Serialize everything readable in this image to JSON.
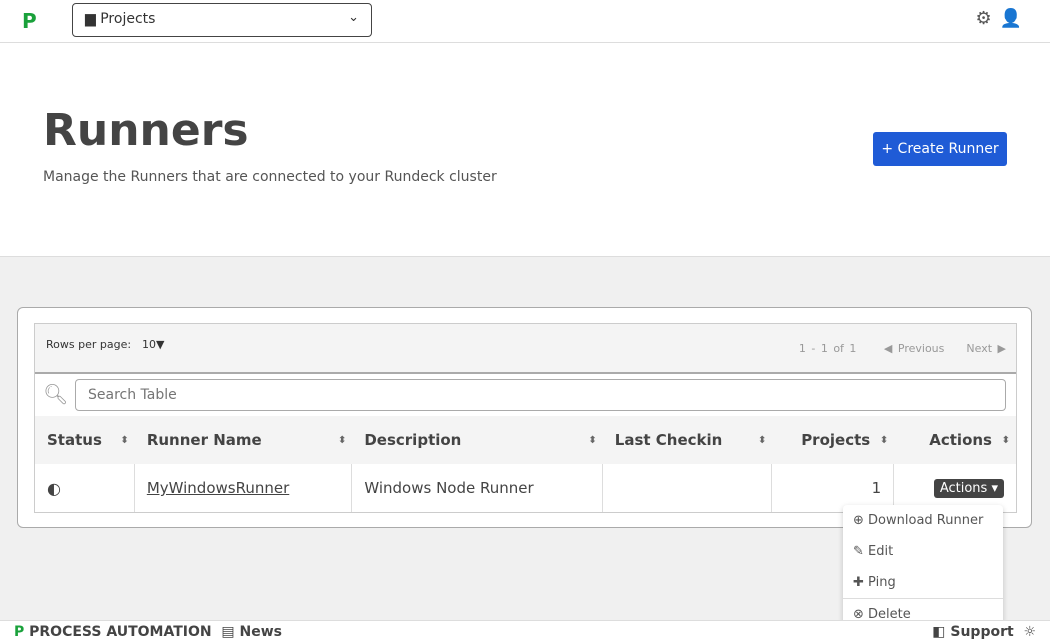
{
  "topbar": {
    "project_selector": "Projects"
  },
  "header": {
    "title": "Runners",
    "subtitle": "Manage the Runners that are connected to your Rundeck cluster",
    "create_label": "+ Create Runner"
  },
  "table": {
    "rows_per_page_label": "Rows per page:",
    "rows_per_page": "10",
    "page_info": "1 - 1 of 1",
    "previous": "Previous",
    "next": "Next",
    "search_placeholder": "Search Table",
    "columns": [
      "Status",
      "Runner Name",
      "Description",
      "Last Checkin",
      "Projects",
      "Actions"
    ],
    "rows": [
      {
        "status_icon": "half-circle-icon",
        "name": "MyWindowsRunner",
        "description": "Windows Node Runner",
        "last_checkin": "",
        "projects": "1",
        "actions_label": "Actions"
      }
    ]
  },
  "actions_menu": [
    "Download Runner",
    "Edit",
    "Ping",
    "Delete"
  ],
  "footer": {
    "brand": "PROCESS AUTOMATION",
    "news": "News",
    "support": "Support"
  },
  "colors": {
    "brand": "#1aa13b",
    "primary": "#1f5bd6"
  }
}
